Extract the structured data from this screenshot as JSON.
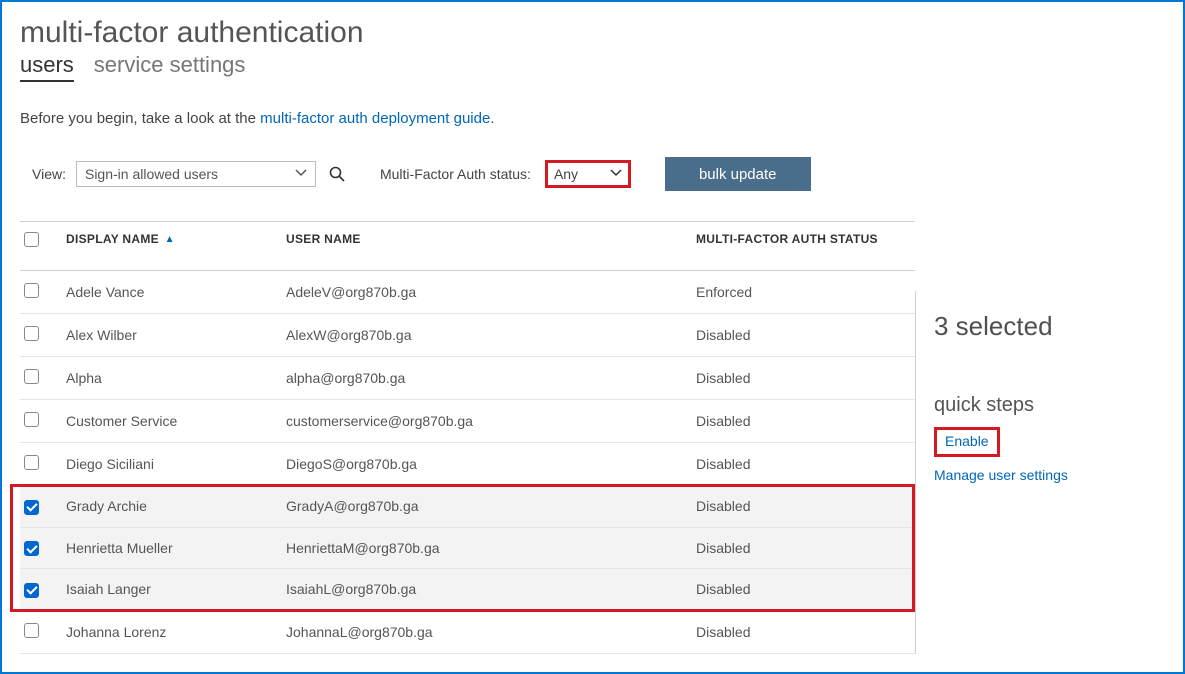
{
  "page_title": "multi-factor authentication",
  "tabs": {
    "users": "users",
    "settings": "service settings",
    "active": "users"
  },
  "intro": {
    "prefix": "Before you begin, take a look at the ",
    "link": "multi-factor auth deployment guide",
    "suffix": "."
  },
  "toolbar": {
    "view_label": "View:",
    "view_value": "Sign-in allowed users",
    "status_label": "Multi-Factor Auth status:",
    "status_value": "Any",
    "bulk_update": "bulk update"
  },
  "table": {
    "columns": {
      "display_name": "DISPLAY NAME",
      "user_name": "USER NAME",
      "mfa_status": "MULTI-FACTOR AUTH STATUS"
    },
    "sort_column": "display_name",
    "rows": [
      {
        "selected": false,
        "display_name": "Adele Vance",
        "user_name": "AdeleV@org870b.ga",
        "mfa_status": "Enforced"
      },
      {
        "selected": false,
        "display_name": "Alex Wilber",
        "user_name": "AlexW@org870b.ga",
        "mfa_status": "Disabled"
      },
      {
        "selected": false,
        "display_name": "Alpha",
        "user_name": "alpha@org870b.ga",
        "mfa_status": "Disabled"
      },
      {
        "selected": false,
        "display_name": "Customer Service",
        "user_name": "customerservice@org870b.ga",
        "mfa_status": "Disabled"
      },
      {
        "selected": false,
        "display_name": "Diego Siciliani",
        "user_name": "DiegoS@org870b.ga",
        "mfa_status": "Disabled"
      },
      {
        "selected": true,
        "display_name": "Grady Archie",
        "user_name": "GradyA@org870b.ga",
        "mfa_status": "Disabled"
      },
      {
        "selected": true,
        "display_name": "Henrietta Mueller",
        "user_name": "HenriettaM@org870b.ga",
        "mfa_status": "Disabled"
      },
      {
        "selected": true,
        "display_name": "Isaiah Langer",
        "user_name": "IsaiahL@org870b.ga",
        "mfa_status": "Disabled"
      },
      {
        "selected": false,
        "display_name": "Johanna Lorenz",
        "user_name": "JohannaL@org870b.ga",
        "mfa_status": "Disabled"
      }
    ]
  },
  "side": {
    "selected_count": "3 selected",
    "quick_steps_heading": "quick steps",
    "enable": "Enable",
    "manage": "Manage user settings"
  }
}
